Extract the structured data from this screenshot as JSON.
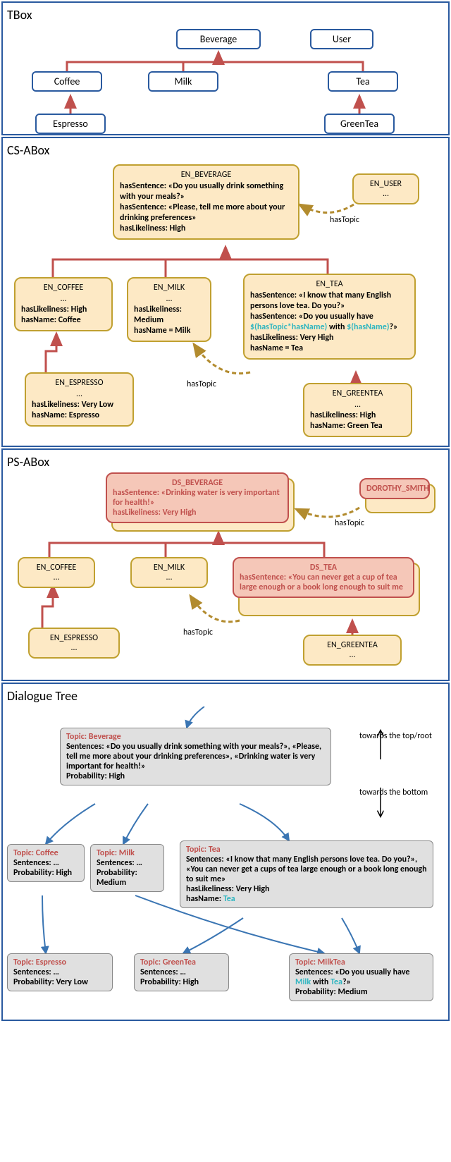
{
  "tbox": {
    "title": "TBox",
    "nodes": {
      "beverage": "Beverage",
      "user": "User",
      "coffee": "Coffee",
      "milk": "Milk",
      "tea": "Tea",
      "espresso": "Espresso",
      "greentea": "GreenTea"
    }
  },
  "csabox": {
    "title": "CS-ABox",
    "beverage": {
      "name": "EN_BEVERAGE",
      "s1": "hasSentence: «Do you usually drink something with your meals?»",
      "s2": "hasSentence: «Please, tell me more about your drinking preferences»",
      "like": "hasLikeliness: High"
    },
    "user": {
      "name": "EN_USER",
      "dots": "…"
    },
    "coffee": {
      "name": "EN_COFFEE",
      "dots": "…",
      "like": "hasLikeliness: High",
      "hname": "hasName: Coffee"
    },
    "milk": {
      "name": "EN_MILK",
      "dots": "…",
      "like": "hasLikeliness: Medium",
      "hname": "hasName = Milk"
    },
    "tea": {
      "name": "EN_TEA",
      "s1": "hasSentence: «I know that many English persons love tea. Do you?»",
      "s2a": "hasSentence: «Do you usually have ",
      "var1": "$(hasTopic*hasName)",
      "s2b": " with ",
      "var2": "$(hasName)",
      "s2c": "?»",
      "like": "hasLikeliness: Very High",
      "hname": "hasName = Tea"
    },
    "espresso": {
      "name": "EN_ESPRESSO",
      "dots": "…",
      "like": "hasLikeliness: Very Low",
      "hname": "hasName: Espresso"
    },
    "greentea": {
      "name": "EN_GREENTEA",
      "dots": "…",
      "like": "hasLikeliness: High",
      "hname": "hasName: Green Tea"
    },
    "hasTopic": "hasTopic"
  },
  "psabox": {
    "title": "PS-ABox",
    "beverage": {
      "name": "DS_BEVERAGE",
      "s1": "hasSentence: «Drinking water is very important for health!»",
      "like": "hasLikeliness: Very High"
    },
    "dorothy": {
      "name": "DOROTHY_SMITH"
    },
    "coffee": {
      "name": "EN_COFFEE",
      "dots": "…"
    },
    "milk": {
      "name": "EN_MILK",
      "dots": "…"
    },
    "tea": {
      "name": "DS_TEA",
      "s1": "hasSentence: «You can never get a cup of tea large enough or a book long enough to suit me"
    },
    "espresso": {
      "name": "EN_ESPRESSO",
      "dots": "…"
    },
    "greentea": {
      "name": "EN_GREENTEA",
      "dots": "…"
    },
    "hasTopic": "hasTopic"
  },
  "dlg": {
    "title": "Dialogue Tree",
    "legend_top": "towards the top/root",
    "legend_bottom": "towards the bottom",
    "beverage": {
      "topic": "Topic: Beverage",
      "s": "Sentences: «Do you usually drink something with your meals?», «Please, tell me more about your drinking preferences», «Drinking water is very important for health!»",
      "p": "Probability: High"
    },
    "coffee": {
      "topic": "Topic: Coffee",
      "s": "Sentences: …",
      "p": "Probability: High"
    },
    "milk": {
      "topic": "Topic: Milk",
      "s": "Sentences: …",
      "p": "Probability: Medium"
    },
    "tea": {
      "topic": "Topic: Tea",
      "s1": "Sentences: «I know that many English persons love tea. Do you?», «You can never get a cups of tea large enough or a book long enough to suit me»",
      "like": "hasLikeliness: Very High",
      "hname_lbl": "hasName: ",
      "hname_val": "Tea"
    },
    "espresso": {
      "topic": "Topic: Espresso",
      "s": "Sentences: …",
      "p": "Probability: Very Low"
    },
    "greentea": {
      "topic": "Topic: GreenTea",
      "s": "Sentences: …",
      "p": "Probability: High"
    },
    "milktea": {
      "topic": "Topic: MilkTea",
      "s_lbl": "Sentences",
      "s_a": ": «Do you usually have ",
      "v1": "Milk",
      "s_b": " with ",
      "v2": "Tea",
      "s_c": "?»",
      "p": "Probability: Medium"
    }
  }
}
